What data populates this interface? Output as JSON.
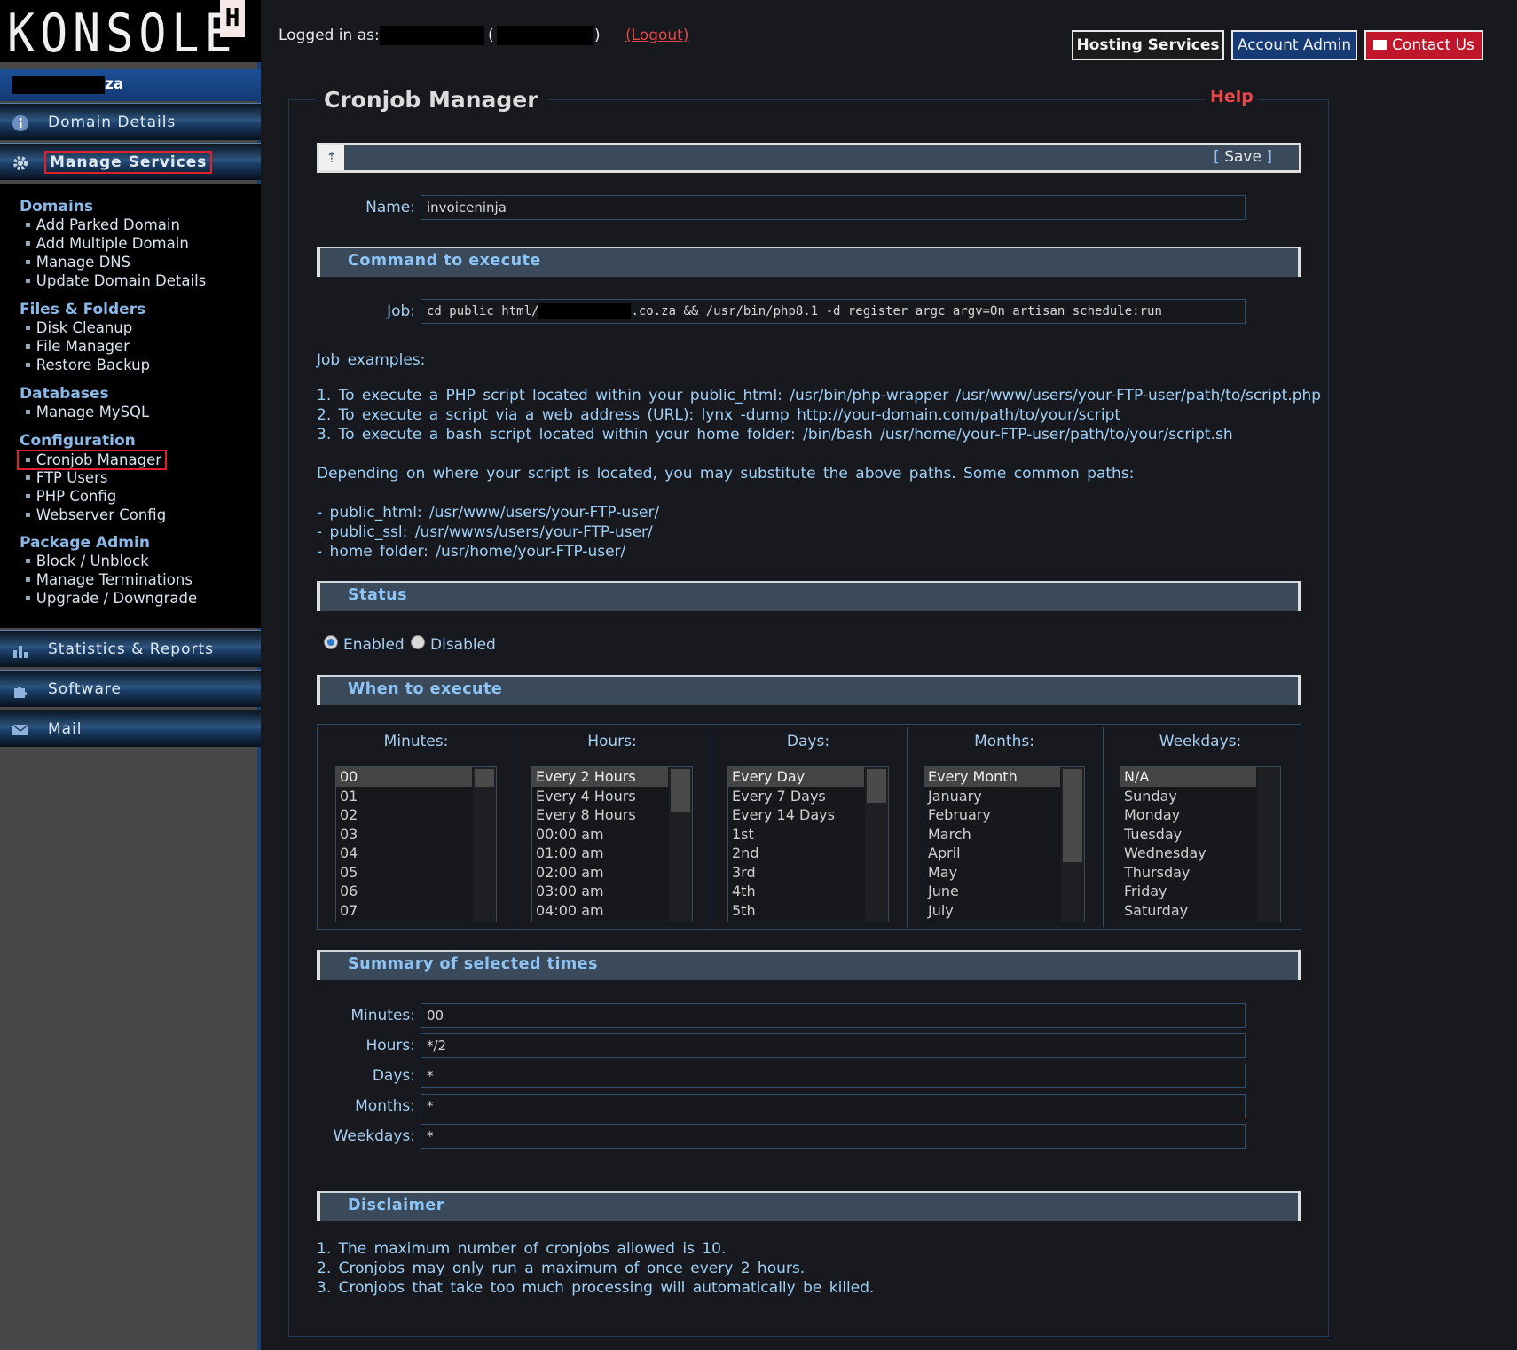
{
  "logo": {
    "brand": "KONSOLE",
    "badge": "H"
  },
  "sidebar": {
    "domain_suffix": "za",
    "headers": [
      {
        "label": "Domain Details",
        "icon": "info-icon"
      },
      {
        "label": "Manage Services",
        "icon": "gear-icon"
      },
      {
        "label": "Statistics & Reports",
        "icon": "bar-chart-icon"
      },
      {
        "label": "Software",
        "icon": "puzzle-icon"
      },
      {
        "label": "Mail",
        "icon": "envelope-icon"
      }
    ],
    "groups": [
      {
        "title": "Domains",
        "items": [
          "Add Parked Domain",
          "Add Multiple Domain",
          "Manage DNS",
          "Update Domain Details"
        ]
      },
      {
        "title": "Files & Folders",
        "items": [
          "Disk Cleanup",
          "File Manager",
          "Restore Backup"
        ]
      },
      {
        "title": "Databases",
        "items": [
          "Manage MySQL"
        ]
      },
      {
        "title": "Configuration",
        "items": [
          "Cronjob Manager",
          "FTP Users",
          "PHP Config",
          "Webserver Config"
        ]
      },
      {
        "title": "Package Admin",
        "items": [
          "Block / Unblock",
          "Manage Terminations",
          "Upgrade / Downgrade"
        ]
      }
    ]
  },
  "header": {
    "logged_in_label": "Logged in as:",
    "paren_open": "(",
    "paren_close": ")",
    "logout": "(Logout)",
    "buttons": {
      "hosting": "Hosting Services",
      "account": "Account Admin",
      "contact": "Contact Us"
    }
  },
  "page": {
    "title": "Cronjob Manager",
    "help": "Help",
    "save_open": "[",
    "save": "Save",
    "save_close": "]",
    "name_label": "Name:",
    "name_value": "invoiceninja",
    "command_section": "Command to execute",
    "job_label": "Job:",
    "job_prefix": "cd public_html/",
    "job_suffix": ".co.za && /usr/bin/php8.1 -d register_argc_argv=On artisan schedule:run",
    "examples_title": "Job examples:",
    "examples": [
      "1. To execute a PHP script located within your public_html: /usr/bin/php-wrapper /usr/www/users/your-FTP-user/path/to/script.php",
      "2. To execute a script via a web address (URL): lynx -dump http://your-domain.com/path/to/your/script",
      "3. To execute a bash script located within your home folder: /bin/bash /usr/home/your-FTP-user/path/to/your/script.sh"
    ],
    "paths_intro": "Depending on where your script is located, you may substitute the above paths. Some common paths:",
    "paths": [
      "- public_html: /usr/www/users/your-FTP-user/",
      "- public_ssl: /usr/wwws/users/your-FTP-user/",
      "- home folder: /usr/home/your-FTP-user/"
    ],
    "status_section": "Status",
    "status_enabled": "Enabled",
    "status_disabled": "Disabled",
    "status_value": "Enabled",
    "when_section": "When to execute",
    "columns": [
      {
        "label": "Minutes:",
        "options": [
          "00",
          "01",
          "02",
          "03",
          "04",
          "05",
          "06",
          "07"
        ],
        "selected": "00"
      },
      {
        "label": "Hours:",
        "options": [
          "Every 2 Hours",
          "Every 4 Hours",
          "Every 8 Hours",
          "00:00 am",
          "01:00 am",
          "02:00 am",
          "03:00 am",
          "04:00 am"
        ],
        "selected": "Every 2 Hours"
      },
      {
        "label": "Days:",
        "options": [
          "Every Day",
          "Every 7 Days",
          "Every 14 Days",
          "1st",
          "2nd",
          "3rd",
          "4th",
          "5th"
        ],
        "selected": "Every Day"
      },
      {
        "label": "Months:",
        "options": [
          "Every Month",
          "January",
          "February",
          "March",
          "April",
          "May",
          "June",
          "July"
        ],
        "selected": "Every Month"
      },
      {
        "label": "Weekdays:",
        "options": [
          "N/A",
          "Sunday",
          "Monday",
          "Tuesday",
          "Wednesday",
          "Thursday",
          "Friday",
          "Saturday"
        ],
        "selected": "N/A"
      }
    ],
    "summary_section": "Summary of selected times",
    "summary": [
      {
        "label": "Minutes:",
        "value": "00"
      },
      {
        "label": "Hours:",
        "value": "*/2"
      },
      {
        "label": "Days:",
        "value": "*"
      },
      {
        "label": "Months:",
        "value": "*"
      },
      {
        "label": "Weekdays:",
        "value": "*"
      }
    ],
    "disclaimer_section": "Disclaimer",
    "disclaimer": [
      "1. The maximum number of cronjobs allowed is 10.",
      "2. Cronjobs may only run a maximum of once every 2 hours.",
      "3. Cronjobs that take too much processing will automatically be killed."
    ]
  },
  "colors": {
    "accent_blue": "#8ec4f5",
    "brand_red": "#c0162c",
    "nav_blue": "#153a74",
    "highlight_red": "#e0202a"
  }
}
